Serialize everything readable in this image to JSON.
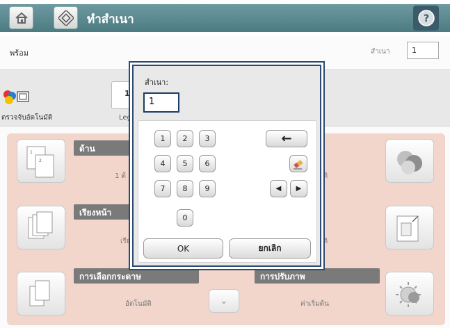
{
  "header": {
    "title": "ทำสำเนา",
    "home_icon": "home-icon",
    "app_icon": "copy-icon",
    "help_icon": "help-icon",
    "help_glyph": "?"
  },
  "status": {
    "text": "พร้อม",
    "copies_label": "สำเนา",
    "copies_value": "1"
  },
  "top_strip": {
    "autodetect_label": "ตรวจจับอัตโนมัติ",
    "paper_value": "1",
    "paper_label": "Leg"
  },
  "tiles": {
    "sides": {
      "title": "ด้าน",
      "value": "1 ด้"
    },
    "collate": {
      "title": "เรียงหน้า",
      "value": "เรีย"
    },
    "content": {
      "title": "การเลือกกระดาษ",
      "value": "อัตโนมัติ"
    },
    "adjust": {
      "title": "การปรับภาพ",
      "value": "ค่าเริ่มต้น"
    },
    "right_top_value": "มัติ",
    "right_mid_value": "มัติ"
  },
  "dialog": {
    "label": "สำเนา:",
    "input_value": "1",
    "keys": [
      "1",
      "2",
      "3",
      "4",
      "5",
      "6",
      "7",
      "8",
      "9",
      "0"
    ],
    "backspace_glyph": "←",
    "left_glyph": "◀",
    "right_glyph": "▶",
    "ok_label": "OK",
    "cancel_label": "ยกเลิก"
  },
  "more": {
    "glyph": "⌄"
  },
  "colors": {
    "title_band": "#5a8990",
    "panel": "#f2d6cb",
    "tile_header": "#7a7a7a",
    "dialog_border": "#2d4b72"
  }
}
